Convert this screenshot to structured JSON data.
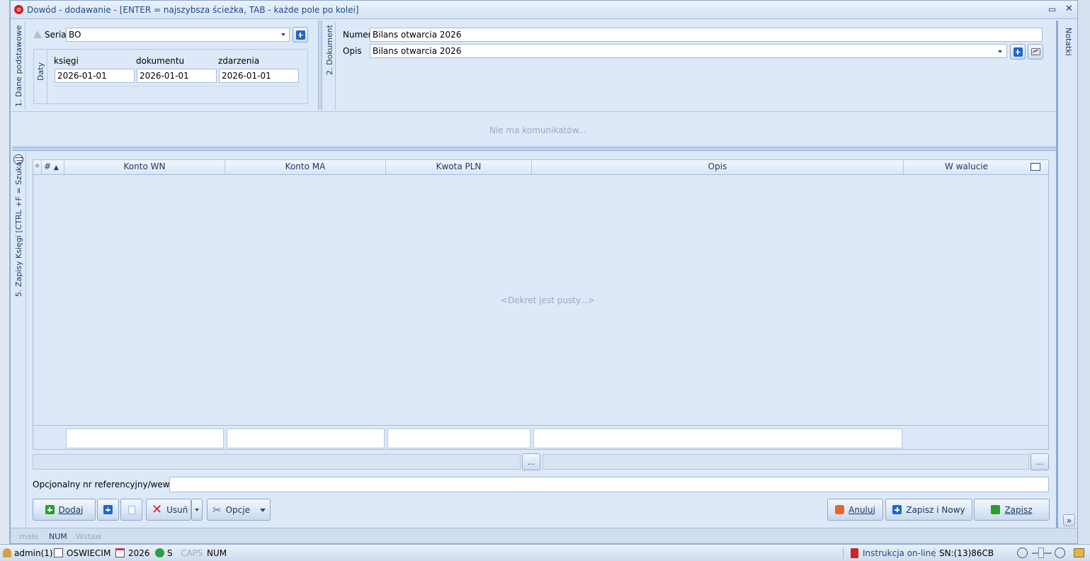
{
  "window": {
    "title": "Dowód - dodawanie - [ENTER = najszybsza ścieżka, TAB - każde pole po kolei]",
    "restore_glyph": "▭",
    "close_glyph": "✕"
  },
  "tabs": {
    "basic": "1. Dane podstawowe",
    "document": "2. Dokument",
    "entries": "5. Zapisy Księgi [CTRL +F = Szukaj]",
    "notes": "Notatki"
  },
  "basic": {
    "seria_label": "Seria",
    "seria_value": "BO",
    "dates_label": "Daty",
    "ksiegi_label": "księgi",
    "ksiegi_value": "2026-01-01",
    "dokumentu_label": "dokumentu",
    "dokumentu_value": "2026-01-01",
    "zdarzenia_label": "zdarzenia",
    "zdarzenia_value": "2026-01-01"
  },
  "document": {
    "numer_label": "Numer",
    "numer_value": "Bilans otwarcia 2026",
    "opis_label": "Opis",
    "opis_value": "Bilans otwarcia 2026"
  },
  "messages": {
    "empty": "Nie ma komunikatów..."
  },
  "grid": {
    "hash_col": "#",
    "sort_glyph": "▲",
    "columns": [
      "Konto WN",
      "Konto MA",
      "Kwota PLN",
      "Opis",
      "W walucie"
    ],
    "empty_text": "<Dekret jest pusty...>"
  },
  "reference": {
    "label": "Opcjonalny nr referencyjny/wewn.",
    "value": ""
  },
  "ellipsis": "...",
  "buttons": {
    "dodaj": "Dodaj",
    "usun": "Usuń",
    "opcje": "Opcje",
    "anuluj": "Anuluj",
    "zapisz_nowy": "Zapisz i Nowy",
    "zapisz": "Zapisz",
    "expand": "»"
  },
  "inner_status": {
    "male": "małe",
    "num": "NUM",
    "wstaw": "Wstaw"
  },
  "statusbar": {
    "user": "admin(1)",
    "company": "OSWIECIM",
    "year": "2026",
    "s": "S",
    "caps": "CAPS",
    "num": "NUM",
    "instruction": "Instrukcja on-line",
    "sn": "SN:(13)86CB"
  },
  "colors": {
    "title_bar": "#dce8f7",
    "panel": "#dde9f9",
    "accent_blue": "#1f67c6",
    "delete_red": "#d42020",
    "cancel_orange": "#e8642a"
  }
}
